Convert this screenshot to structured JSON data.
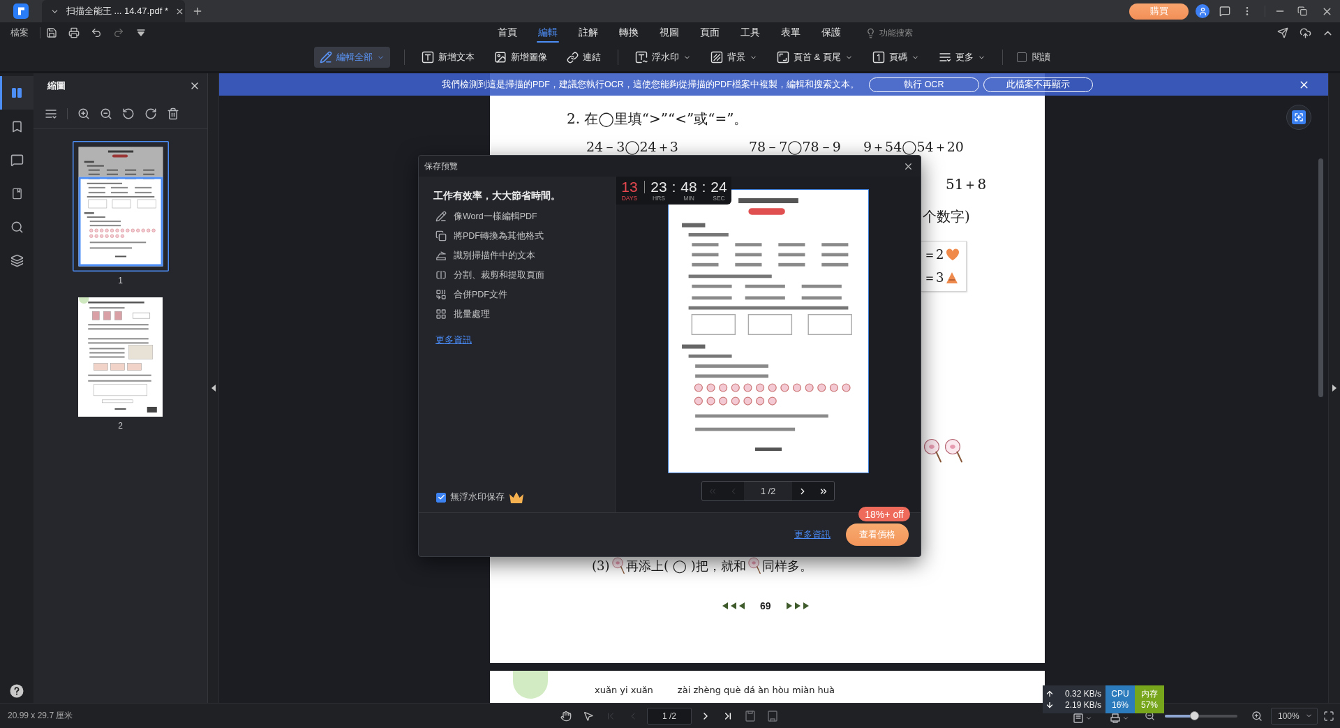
{
  "title_bar": {
    "tab_title": "扫描全能王 ... 14.47.pdf *",
    "buy_button": "購買"
  },
  "menu_bar": {
    "file": "檔案",
    "tabs": [
      {
        "label": "首頁",
        "selected": false
      },
      {
        "label": "編輯",
        "selected": true
      },
      {
        "label": "註解",
        "selected": false
      },
      {
        "label": "轉換",
        "selected": false
      },
      {
        "label": "視圖",
        "selected": false
      },
      {
        "label": "頁面",
        "selected": false
      },
      {
        "label": "工具",
        "selected": false
      },
      {
        "label": "表單",
        "selected": false
      },
      {
        "label": "保護",
        "selected": false
      }
    ],
    "feature_search": "功能搜索"
  },
  "toolbar": {
    "items": [
      {
        "label": "編輯全部",
        "selected": true,
        "dropdown": true
      },
      {
        "label": "新增文本",
        "selected": false,
        "dropdown": false
      },
      {
        "label": "新增圖像",
        "selected": false,
        "dropdown": false
      },
      {
        "label": "連結",
        "selected": false,
        "dropdown": false
      },
      {
        "label": "浮水印",
        "selected": false,
        "dropdown": true
      },
      {
        "label": "背景",
        "selected": false,
        "dropdown": true
      },
      {
        "label": "頁首 & 頁尾",
        "selected": false,
        "dropdown": true
      },
      {
        "label": "頁碼",
        "selected": false,
        "dropdown": true
      },
      {
        "label": "更多",
        "selected": false,
        "dropdown": true
      }
    ],
    "read_mode": {
      "label": "閱讀",
      "checked": false
    }
  },
  "sidebar_icons": [
    {
      "selected": true
    },
    {
      "selected": false
    },
    {
      "selected": false
    },
    {
      "selected": false
    },
    {
      "selected": false
    },
    {
      "selected": false
    }
  ],
  "thumbnail_panel": {
    "title": "縮圖",
    "thumbnails": [
      {
        "label": "1",
        "selected": true
      },
      {
        "label": "2",
        "selected": false
      }
    ]
  },
  "ocr_banner": {
    "message": "我們檢測到這是掃描的PDF，建議您執行OCR，這使您能夠從掃描的PDF檔案中複製，編輯和搜索文本。",
    "buttons": [
      "執行 OCR",
      "此檔案不再顯示"
    ]
  },
  "document": {
    "page_1": {
      "instruction": "2. 在◯里填“>”“<”或“=”。",
      "compare_row": [
        "24－3◯24＋3",
        "78－7◯78－9",
        "9＋54◯54＋20"
      ],
      "fragments": [
        "51＋8",
        "个数字)"
      ],
      "card_rows": [
        {
          "text": "＝2",
          "kind": "heart"
        },
        {
          "text": "＝3",
          "kind": "triangle"
        }
      ],
      "question_3": {
        "number": "(3)",
        "middle": "再添上( ◯ )把，就和",
        "end": "同样多。"
      },
      "page_number": "69"
    },
    "page_2": {
      "pinyin": [
        "xuǎn yi xuǎn",
        "zài zhèng què dá àn hòu miàn huà"
      ]
    }
  },
  "dialog": {
    "title": "保存預覽",
    "headline": "工作有效率，大大節省時間。",
    "features": [
      "像Word一樣編輯PDF",
      "將PDF轉換為其他格式",
      "識別掃描件中的文本",
      "分割、裁剪和提取頁面",
      "合併PDF文件",
      "批量處理"
    ],
    "more_link": "更多資訊",
    "no_watermark": {
      "label": "無浮水印保存",
      "checked": true
    },
    "countdown": [
      {
        "kind": "days",
        "value": "13",
        "label": "DAYS"
      },
      {
        "kind": "time",
        "value": "23",
        "label": "HRS"
      },
      {
        "kind": "colon",
        "value": ":"
      },
      {
        "kind": "time",
        "value": "48",
        "label": "MIN"
      },
      {
        "kind": "colon",
        "value": ":"
      },
      {
        "kind": "time",
        "value": "24",
        "label": "SEC"
      }
    ],
    "pager": {
      "page": "1 /2",
      "nav_buttons": [
        {
          "disabled": true
        },
        {
          "disabled": true
        },
        {
          "disabled": false
        },
        {
          "disabled": false
        }
      ]
    },
    "footer_link": "更多資訊",
    "price_button": "查看價格",
    "discount_badge": "18%+ off"
  },
  "status_bar": {
    "page_size": "20.99 x 29.7 厘米",
    "nav_buttons": [
      {
        "disabled": true
      },
      {
        "disabled": true
      },
      {
        "disabled": false
      },
      {
        "disabled": false
      }
    ],
    "page_field": "1 /2",
    "zoom_slider": {
      "level": 0.4
    },
    "zoom": "100%"
  },
  "system_monitor": {
    "upload": "0.32 KB/s",
    "download": "2.19 KB/s",
    "cpu_label": "CPU",
    "cpu": "16%",
    "memory_label": "内存",
    "memory": "57%"
  }
}
